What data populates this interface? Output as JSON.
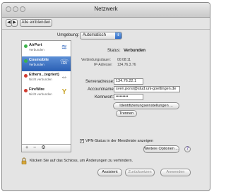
{
  "window": {
    "title": "Netzwerk",
    "show_all_label": "Alle einblenden",
    "nav_back": "◀",
    "nav_fwd": "▶",
    "grid_icon": "⁝⁝⁝"
  },
  "location": {
    "label": "Umgebung:",
    "value": "Automatisch"
  },
  "services": [
    {
      "name": "AirPort",
      "status": "Verbunden",
      "dot_color": "#3cb34a",
      "icon": "wifi-icon",
      "glyph": "≋"
    },
    {
      "name": "Cosmobile",
      "status": "Verbunden",
      "dot_color": "#3cb34a",
      "icon": "phone-icon",
      "glyph": "☏"
    },
    {
      "name": "Ethern...tegriert)",
      "status": "Nicht verbunden",
      "dot_color": "#d03a2f",
      "icon": "ethernet-icon",
      "glyph": "⇔"
    },
    {
      "name": "FireWire",
      "status": "Nicht verbunden",
      "dot_color": "#d03a2f",
      "icon": "firewire-icon",
      "glyph": "Y"
    }
  ],
  "sidebar_tools": {
    "add": "+",
    "remove": "−",
    "gear": "⚙"
  },
  "status": {
    "label": "Status:",
    "value": "Verbunden",
    "duration_label": "Verbindungsdauer:",
    "duration_value": "00:08:11",
    "ip_label": "IP-Adresse:",
    "ip_value": "134.76.3.76"
  },
  "form": {
    "server_label": "Serveradresse:",
    "server_value": "134.76.22.1",
    "account_label": "Accountname:",
    "account_value": "sven.porst@stud.uni-goettingen.de",
    "password_label": "Kennwort:",
    "password_value": "•••••••••",
    "auth_button": "Identifizierungseinstellungen ...",
    "disconnect_button": "Trennen"
  },
  "vpn_menu": {
    "label": "VPN-Status in der Menüleiste anzeigen",
    "checked": "✓"
  },
  "more_options_button": "Weitere Optionen ...",
  "help": "?",
  "lock_text": "Klicken Sie auf das Schloss, um Änderungen zu verhindern.",
  "bottom": {
    "assistant": "Assistent",
    "revert": "Zurücksetzen",
    "apply": "Anwenden"
  }
}
